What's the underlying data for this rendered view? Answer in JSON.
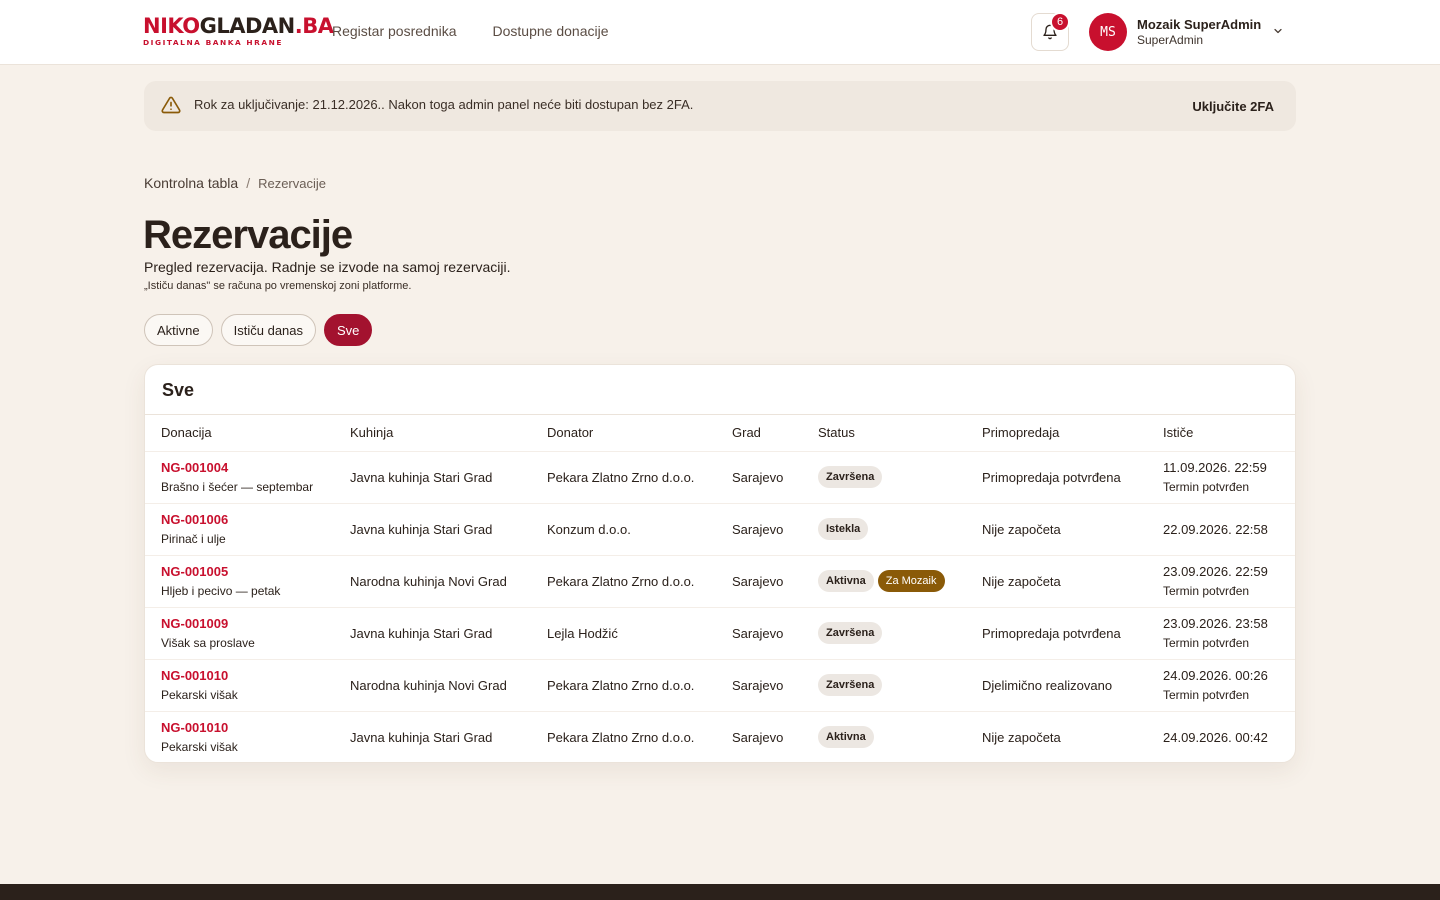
{
  "brand": {
    "logo_red": "NIKO",
    "logo_dark": "GLADAN",
    "logo_tld": ".BA",
    "tagline": "DIGITALNA BANKA HRANE"
  },
  "nav": [
    {
      "label": "Registar posrednika"
    },
    {
      "label": "Dostupne donacije"
    }
  ],
  "notifications": {
    "count": "6",
    "icon": "bell-icon"
  },
  "user": {
    "initials": "MS",
    "name": "Mozaik SuperAdmin",
    "role": "SuperAdmin"
  },
  "alert": {
    "text": "Rok za uključivanje: 21.12.2026.. Nakon toga admin panel neće biti dostupan bez 2FA.",
    "action": "Uključite 2FA",
    "icon": "warning-icon"
  },
  "breadcrumb": {
    "home": "Kontrolna tabla",
    "separator": "/",
    "current": "Rezervacije"
  },
  "page": {
    "title": "Rezervacije",
    "subtitle": "Pregled rezervacija. Radnje se izvode na samoj rezervaciji.",
    "note": "„Ističu danas\" se računa po vremenskoj zoni platforme."
  },
  "filters": [
    {
      "label": "Aktivne"
    },
    {
      "label": "Ističu danas"
    },
    {
      "label": "Sve"
    }
  ],
  "table": {
    "title": "Sve",
    "headers": [
      "Donacija",
      "Kuhinja",
      "Donator",
      "Grad",
      "Status",
      "Primopredaja",
      "Ističe"
    ],
    "rows": [
      {
        "id": "NG-001004",
        "name": "Brašno i šećer — septembar",
        "kitchen": "Javna kuhinja Stari Grad",
        "donor": "Pekara Zlatno Zrno d.o.o.",
        "city": "Sarajevo",
        "status": "Završena",
        "handover": "Primopredaja potvrđena",
        "expires": "11.09.2026. 22:59",
        "expires_sub": "Termin potvrđen"
      },
      {
        "id": "NG-001006",
        "name": "Pirinač i ulje",
        "kitchen": "Javna kuhinja Stari Grad",
        "donor": "Konzum d.o.o.",
        "city": "Sarajevo",
        "status": "Istekla",
        "handover": "Nije započeta",
        "expires": "22.09.2026. 22:58",
        "expires_sub": ""
      },
      {
        "id": "NG-001005",
        "name": "Hljeb i pecivo — petak",
        "kitchen": "Narodna kuhinja Novi Grad",
        "donor": "Pekara Zlatno Zrno d.o.o.",
        "city": "Sarajevo",
        "status": "Aktivna",
        "extra_badge": "Za Mozaik",
        "handover": "Nije započeta",
        "expires": "23.09.2026. 22:59",
        "expires_sub": "Termin potvrđen"
      },
      {
        "id": "NG-001009",
        "name": "Višak sa proslave",
        "kitchen": "Javna kuhinja Stari Grad",
        "donor": "Lejla Hodžić",
        "city": "Sarajevo",
        "status": "Završena",
        "handover": "Primopredaja potvrđena",
        "expires": "23.09.2026. 23:58",
        "expires_sub": "Termin potvrđen"
      },
      {
        "id": "NG-001010",
        "name": "Pekarski višak",
        "kitchen": "Narodna kuhinja Novi Grad",
        "donor": "Pekara Zlatno Zrno d.o.o.",
        "city": "Sarajevo",
        "status": "Završena",
        "handover": "Djelimično realizovano",
        "expires": "24.09.2026. 00:26",
        "expires_sub": "Termin potvrđen"
      },
      {
        "id": "NG-001010",
        "name": "Pekarski višak",
        "kitchen": "Javna kuhinja Stari Grad",
        "donor": "Pekara Zlatno Zrno d.o.o.",
        "city": "Sarajevo",
        "status": "Aktivna",
        "handover": "Nije započeta",
        "expires": "24.09.2026. 00:42",
        "expires_sub": ""
      }
    ]
  },
  "colors": {
    "brand": "#c8102e",
    "active_filter": "#a3122f",
    "background": "#f7f1ea",
    "mozaik_badge": "#8a5a08",
    "footer": "#2b211b"
  }
}
